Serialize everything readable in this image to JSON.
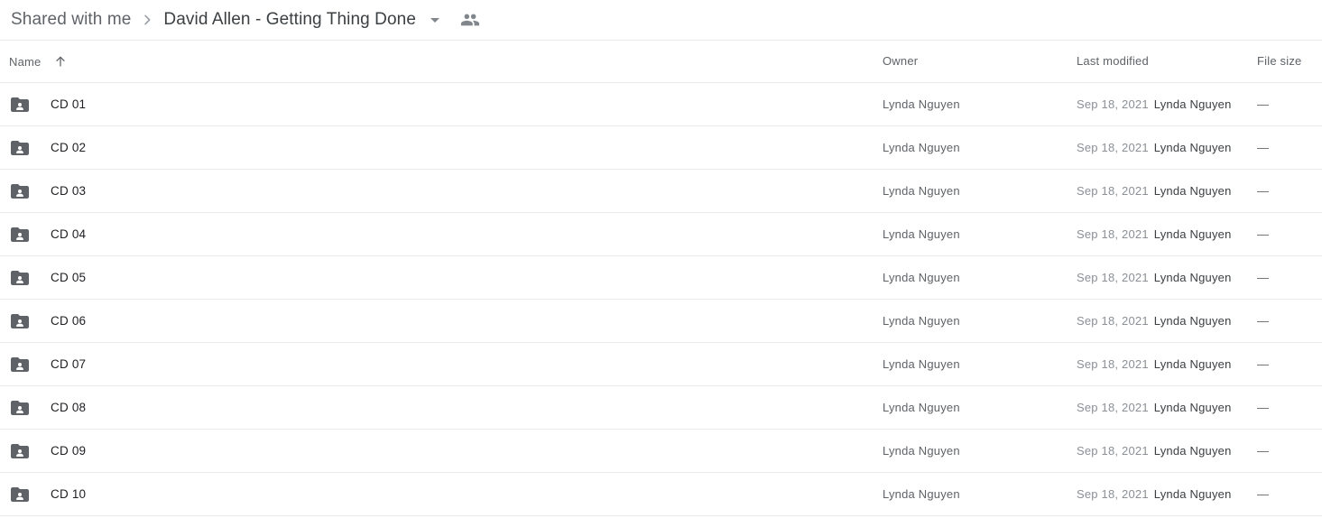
{
  "breadcrumb": {
    "root_label": "Shared with me",
    "separator_icon": "chevron-right-icon",
    "current_label": "David Allen - Getting Thing Done",
    "caret_icon": "chevron-down-icon",
    "people_icon": "people-shared-icon"
  },
  "table": {
    "columns": {
      "name": "Name",
      "owner": "Owner",
      "last_modified": "Last modified",
      "file_size": "File size"
    },
    "sort": {
      "column": "Name",
      "direction": "ascending",
      "icon": "arrow-up-icon"
    },
    "rows": [
      {
        "icon": "shared-folder-icon",
        "name": "CD 01",
        "owner": "Lynda Nguyen",
        "modified_date": "Sep 18, 2021",
        "modified_by": "Lynda Nguyen",
        "size": "—"
      },
      {
        "icon": "shared-folder-icon",
        "name": "CD 02",
        "owner": "Lynda Nguyen",
        "modified_date": "Sep 18, 2021",
        "modified_by": "Lynda Nguyen",
        "size": "—"
      },
      {
        "icon": "shared-folder-icon",
        "name": "CD 03",
        "owner": "Lynda Nguyen",
        "modified_date": "Sep 18, 2021",
        "modified_by": "Lynda Nguyen",
        "size": "—"
      },
      {
        "icon": "shared-folder-icon",
        "name": "CD 04",
        "owner": "Lynda Nguyen",
        "modified_date": "Sep 18, 2021",
        "modified_by": "Lynda Nguyen",
        "size": "—"
      },
      {
        "icon": "shared-folder-icon",
        "name": "CD 05",
        "owner": "Lynda Nguyen",
        "modified_date": "Sep 18, 2021",
        "modified_by": "Lynda Nguyen",
        "size": "—"
      },
      {
        "icon": "shared-folder-icon",
        "name": "CD 06",
        "owner": "Lynda Nguyen",
        "modified_date": "Sep 18, 2021",
        "modified_by": "Lynda Nguyen",
        "size": "—"
      },
      {
        "icon": "shared-folder-icon",
        "name": "CD 07",
        "owner": "Lynda Nguyen",
        "modified_date": "Sep 18, 2021",
        "modified_by": "Lynda Nguyen",
        "size": "—"
      },
      {
        "icon": "shared-folder-icon",
        "name": "CD 08",
        "owner": "Lynda Nguyen",
        "modified_date": "Sep 18, 2021",
        "modified_by": "Lynda Nguyen",
        "size": "—"
      },
      {
        "icon": "shared-folder-icon",
        "name": "CD 09",
        "owner": "Lynda Nguyen",
        "modified_date": "Sep 18, 2021",
        "modified_by": "Lynda Nguyen",
        "size": "—"
      },
      {
        "icon": "shared-folder-icon",
        "name": "CD 10",
        "owner": "Lynda Nguyen",
        "modified_date": "Sep 18, 2021",
        "modified_by": "Lynda Nguyen",
        "size": "—"
      }
    ]
  },
  "colors": {
    "folder_icon": "#5f6368",
    "divider": "#e8eaed",
    "primary_text": "#202124",
    "secondary_text": "#5f6368"
  }
}
